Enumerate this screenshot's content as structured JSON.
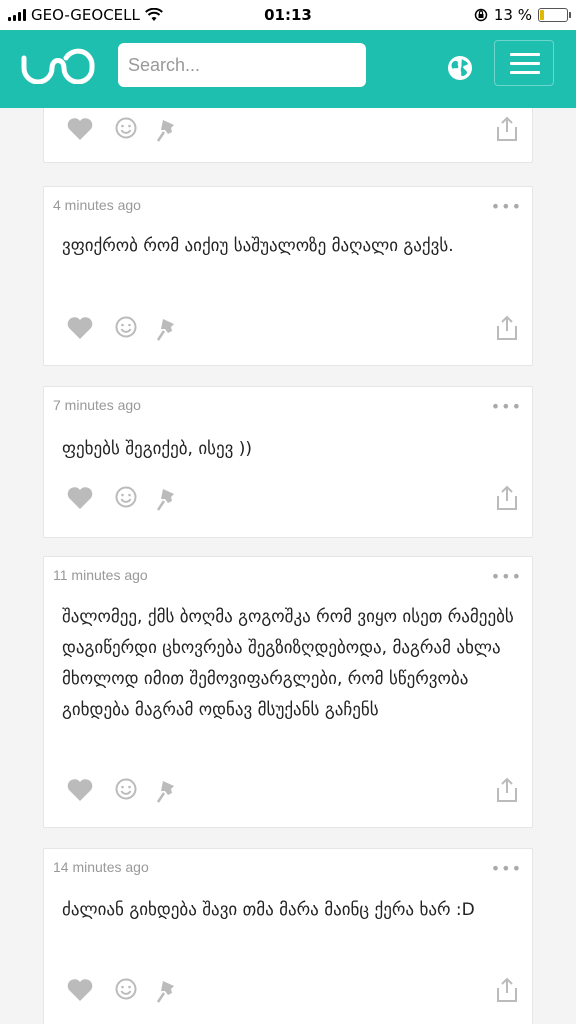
{
  "status_bar": {
    "carrier": "GEO-GEOCELL",
    "time": "01:13",
    "battery": "13 %"
  },
  "header": {
    "search_placeholder": "Search..."
  },
  "posts": [
    {
      "time": "",
      "text": ""
    },
    {
      "time": "4 minutes ago",
      "text": "ვფიქრობ რომ აიქიუ საშუალოზე მაღალი გაქვს."
    },
    {
      "time": "7 minutes ago",
      "text": "ფეხებს შეგიქებ, ისევ ))"
    },
    {
      "time": "11 minutes ago",
      "text": "შალომეე, ქმს ბოღმა გოგოშკა რომ ვიყო ისეთ რამეებს დაგიწერდი ცხოვრება შეგზიზღდებოდა, მაგრამ ახლა მხოლოდ იმით შემოვიფარგლები, რომ სწერვობა გიხდება მაგრამ ოდნავ მსუქანს გაჩენს"
    },
    {
      "time": "14 minutes ago",
      "text": "ძალიან გიხდება შავი თმა მარა მაინც ქერა ხარ :D"
    }
  ]
}
